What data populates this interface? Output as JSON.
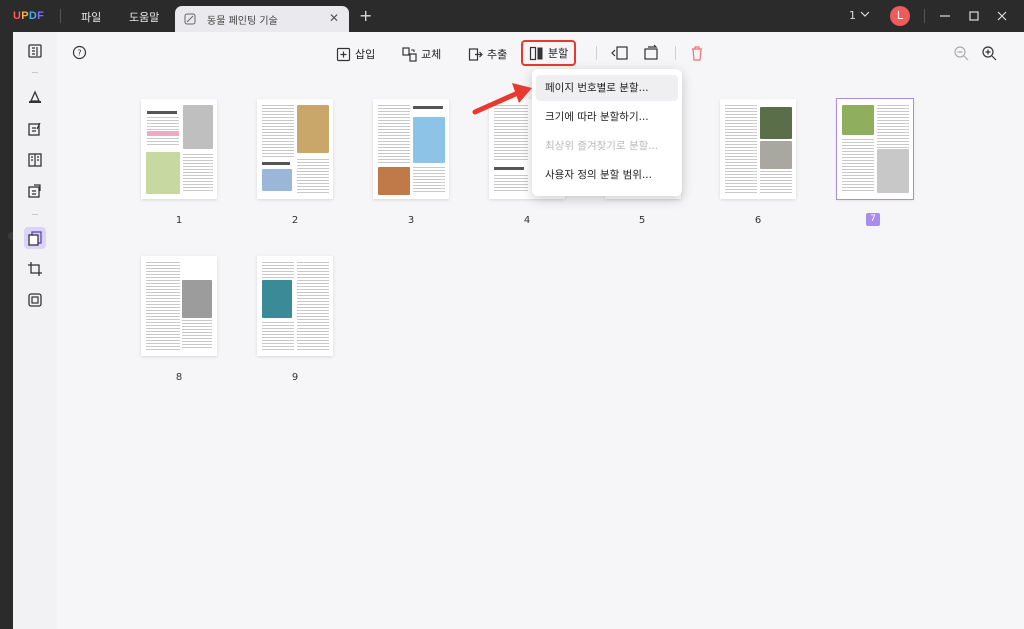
{
  "app": {
    "logo_letters": [
      "U",
      "P",
      "D",
      "F"
    ],
    "logo_colors": [
      "#ff5a5a",
      "#ffb030",
      "#4ea8ff",
      "#7a6bff"
    ]
  },
  "titlebar": {
    "menu_file": "파일",
    "menu_help": "도움말",
    "tab_title": "동물 페인팅 기술",
    "new_tab_symbol": "+",
    "page_count": "1",
    "avatar_letter": "L"
  },
  "toolbar": {
    "insert": "삽입",
    "replace": "교체",
    "extract": "추출",
    "split": "분할"
  },
  "split_menu": {
    "items": [
      {
        "label": "페이지 번호별로 분할...",
        "state": "hover"
      },
      {
        "label": "크기에 따라 분할하기...",
        "state": "normal"
      },
      {
        "label": "최상위 즐겨찾기로 분할...",
        "state": "disabled"
      },
      {
        "label": "사용자 정의 분할 범위...",
        "state": "normal"
      }
    ]
  },
  "pages": [
    {
      "number": "1",
      "selected": false
    },
    {
      "number": "2",
      "selected": false
    },
    {
      "number": "3",
      "selected": false
    },
    {
      "number": "4",
      "selected": false
    },
    {
      "number": "5",
      "selected": false
    },
    {
      "number": "6",
      "selected": false
    },
    {
      "number": "7",
      "selected": true
    },
    {
      "number": "8",
      "selected": false
    },
    {
      "number": "9",
      "selected": false
    }
  ],
  "colors": {
    "accent": "#a88cf0",
    "highlight_red": "#e8392f",
    "titlebar_bg": "#2b2b2b",
    "avatar": "#ef5a5a"
  }
}
